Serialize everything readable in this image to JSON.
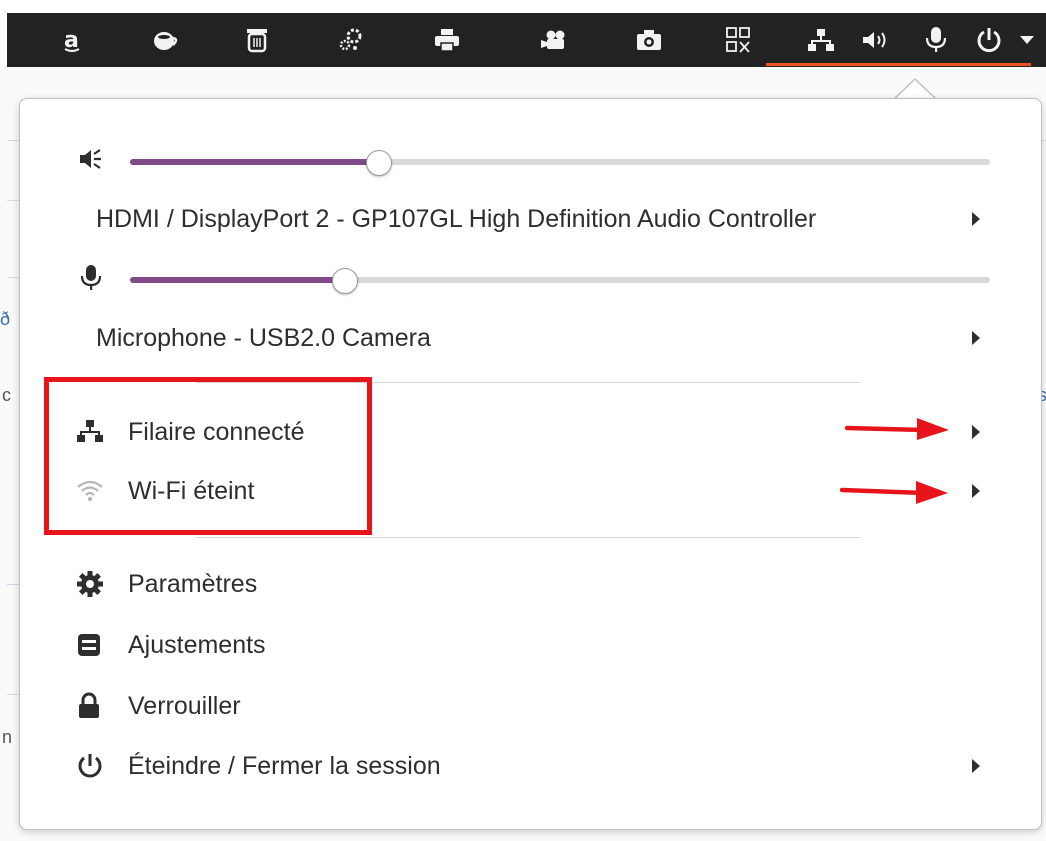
{
  "topbar": {
    "icons": [
      "amazon-icon",
      "coffee-cup-icon",
      "trash-icon",
      "gear-cluster-icon",
      "printer-icon",
      "video-camera-icon",
      "camera-icon",
      "qr-code-icon",
      "wired-network-icon",
      "speaker-icon",
      "microphone-icon",
      "power-icon",
      "dropdown-arrow-icon"
    ],
    "accent": "#e95420"
  },
  "background_window": {
    "fragments": [
      "ð",
      "c",
      "n",
      "s"
    ]
  },
  "menu": {
    "volume_slider": {
      "icon": "speaker-icon",
      "level": 0.29
    },
    "output_device": {
      "label": "HDMI / DisplayPort 2 - GP107GL High Definition Audio Controller"
    },
    "mic_slider": {
      "icon": "microphone-icon",
      "level": 0.25
    },
    "input_device": {
      "label": "Microphone - USB2.0 Camera"
    },
    "network": [
      {
        "icon": "wired-network-icon",
        "label": "Filaire connecté"
      },
      {
        "icon": "wifi-icon",
        "label": "Wi-Fi éteint"
      }
    ],
    "actions": [
      {
        "icon": "gear-icon",
        "label": "Paramètres"
      },
      {
        "icon": "tweaks-icon",
        "label": "Ajustements"
      },
      {
        "icon": "lock-icon",
        "label": "Verrouiller"
      },
      {
        "icon": "power-icon",
        "label": "Éteindre / Fermer la session"
      }
    ],
    "slider_fill_color": "#7f4a87",
    "annotation_color": "#e8141b"
  }
}
